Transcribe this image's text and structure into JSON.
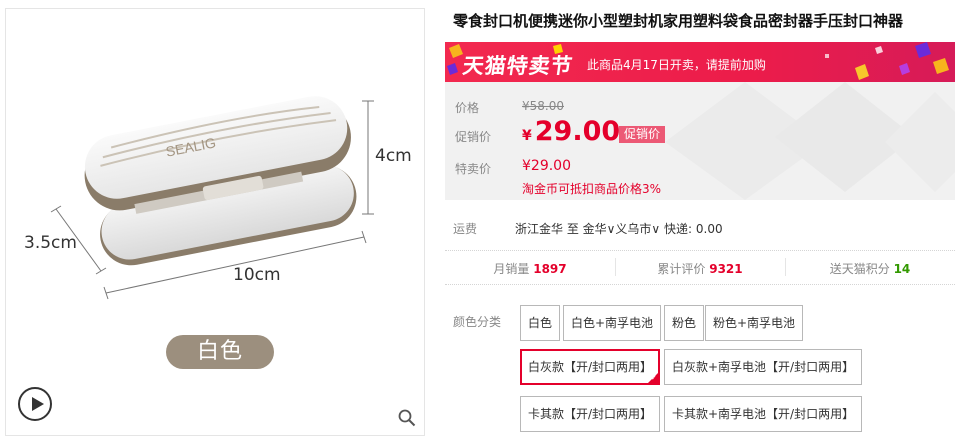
{
  "product": {
    "title": "零食封口机便携迷你小型塑封机家用塑料袋食品密封器手压封口神器"
  },
  "image": {
    "dimensions": {
      "length": "10cm",
      "width": "3.5cm",
      "height": "4cm"
    },
    "color_label": "白色",
    "logo_text": "SEALIG",
    "play_icon": "play-icon",
    "zoom_icon": "zoom-icon"
  },
  "promo": {
    "name": "天猫特卖节",
    "note": "此商品4月17日开卖，请提前加购"
  },
  "price": {
    "original_label": "价格",
    "original_value": "¥58.00",
    "promo_label": "促销价",
    "currency": "¥",
    "promo_value": "29.00",
    "promo_tag": "促销价",
    "special_label": "特卖价",
    "special_value": "¥29.00",
    "coin_note": "淘金币可抵扣商品价格3%"
  },
  "shipping": {
    "label": "运费",
    "text": "浙江金华 至 金华∨义乌市∨ 快递: 0.00"
  },
  "stats": [
    {
      "label": "月销量",
      "value": "1897",
      "color": "#e4002b"
    },
    {
      "label": "累计评价",
      "value": "9321",
      "color": "#e4002b"
    },
    {
      "label": "送天猫积分",
      "value": "14",
      "color": "#339900"
    }
  ],
  "sku": {
    "label": "颜色分类",
    "options": [
      "白色",
      "白色+南孚电池",
      "粉色",
      "粉色+南孚电池",
      "白灰款【开/封口两用】",
      "白灰款+南孚电池【开/封口两用】",
      "卡其款【开/封口两用】",
      "卡其款+南孚电池【开/封口两用】"
    ],
    "selected": "白灰款【开/封口两用】"
  },
  "colors": {
    "accent_red": "#e4002b",
    "promo_banner": "#f2294f",
    "product_khaki": "#9c8f7e"
  }
}
